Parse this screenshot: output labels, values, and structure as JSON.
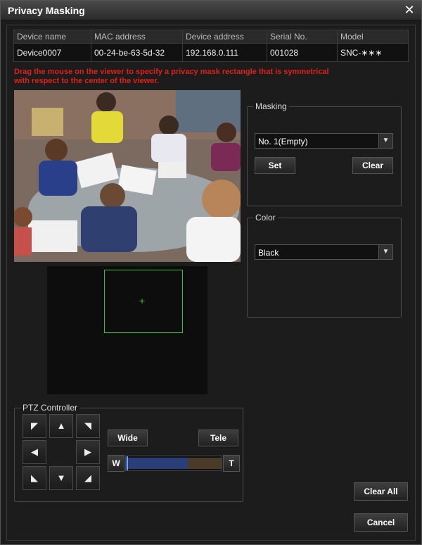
{
  "window": {
    "title": "Privacy Masking",
    "close_glyph": "✕"
  },
  "device_table": {
    "headers": [
      "Device name",
      "MAC address",
      "Device address",
      "Serial No.",
      "Model"
    ],
    "row": [
      "Device0007",
      "00-24-be-63-5d-32",
      "192.168.0.111",
      "001028",
      "SNC-∗∗∗"
    ]
  },
  "instructions": {
    "line1": "Drag the mouse on the viewer to specify a privacy mask rectangle that is symmetrical",
    "line2": "with respect to the center of the viewer."
  },
  "masking": {
    "legend": "Masking",
    "selected": "No. 1(Empty)",
    "set_label": "Set",
    "clear_label": "Clear"
  },
  "color": {
    "legend": "Color",
    "selected": "Black"
  },
  "ptz": {
    "legend": "PTZ Controller",
    "wide_label": "Wide",
    "tele_label": "Tele",
    "w_label": "W",
    "t_label": "T",
    "zoom_level": 0.65
  },
  "footer": {
    "clear_all_label": "Clear All",
    "cancel_label": "Cancel"
  },
  "colors": {
    "instruction_text": "#e0201b",
    "nav_rect": "#3fbf3f"
  }
}
